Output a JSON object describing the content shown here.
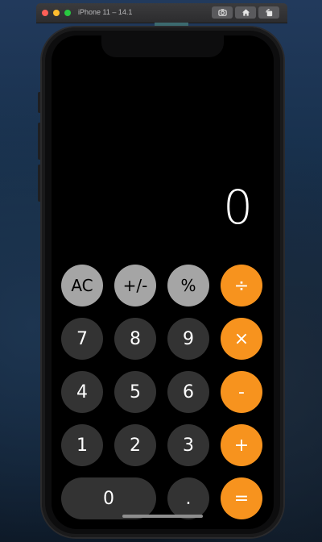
{
  "simulator": {
    "title": "iPhone 11 – 14.1",
    "toolbar_icons": [
      "screenshot-icon",
      "home-icon",
      "rotate-icon"
    ]
  },
  "calculator": {
    "display": "0",
    "rows": [
      [
        {
          "label": "AC",
          "kind": "fn"
        },
        {
          "label": "+/-",
          "kind": "fn"
        },
        {
          "label": "%",
          "kind": "fn"
        },
        {
          "label": "÷",
          "kind": "op"
        }
      ],
      [
        {
          "label": "7",
          "kind": "num"
        },
        {
          "label": "8",
          "kind": "num"
        },
        {
          "label": "9",
          "kind": "num"
        },
        {
          "label": "×",
          "kind": "op"
        }
      ],
      [
        {
          "label": "4",
          "kind": "num"
        },
        {
          "label": "5",
          "kind": "num"
        },
        {
          "label": "6",
          "kind": "num"
        },
        {
          "label": "-",
          "kind": "op"
        }
      ],
      [
        {
          "label": "1",
          "kind": "num"
        },
        {
          "label": "2",
          "kind": "num"
        },
        {
          "label": "3",
          "kind": "num"
        },
        {
          "label": "+",
          "kind": "op"
        }
      ],
      [
        {
          "label": "0",
          "kind": "num"
        },
        {
          "label": ".",
          "kind": "num"
        },
        {
          "label": "=",
          "kind": "op"
        }
      ]
    ],
    "colors": {
      "function": "#a5a5a5",
      "number": "#333333",
      "operator": "#f7931e",
      "background": "#000000"
    }
  }
}
